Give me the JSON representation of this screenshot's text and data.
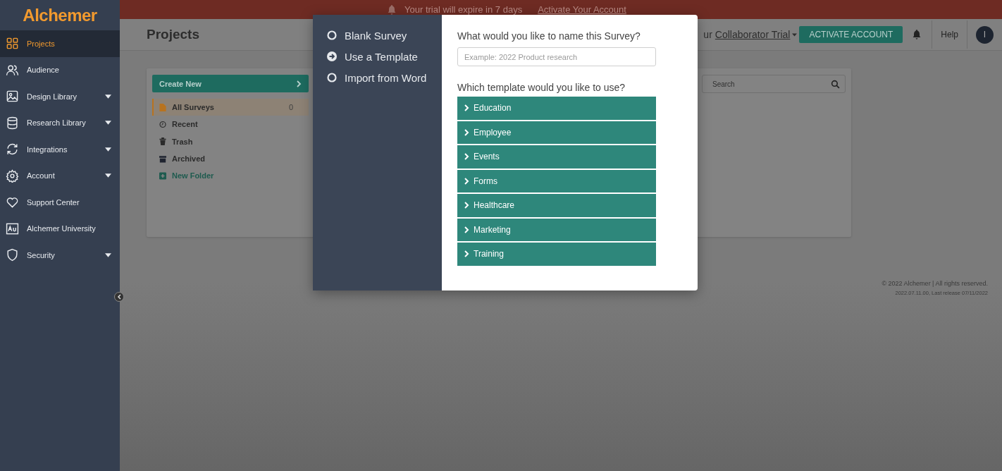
{
  "sidebar": {
    "logo": "Alchemer",
    "items": [
      {
        "label": "Projects",
        "selected": true,
        "has_submenu": false
      },
      {
        "label": "Audience",
        "selected": false,
        "has_submenu": false
      },
      {
        "label": "Design Library",
        "selected": false,
        "has_submenu": true
      },
      {
        "label": "Research Library",
        "selected": false,
        "has_submenu": true
      },
      {
        "label": "Integrations",
        "selected": false,
        "has_submenu": true
      },
      {
        "label": "Account",
        "selected": false,
        "has_submenu": true
      },
      {
        "label": "Support Center",
        "selected": false,
        "has_submenu": false
      },
      {
        "label": "Alchemer University",
        "selected": false,
        "has_submenu": false
      },
      {
        "label": "Security",
        "selected": false,
        "has_submenu": true
      }
    ]
  },
  "banner": {
    "message": "Your trial will expire in 7 days",
    "link": "Activate Your Account"
  },
  "header": {
    "title": "Projects",
    "plan_prefix": "ur",
    "plan_link": "Collaborator Trial",
    "activate_button": "ACTIVATE ACCOUNT",
    "help": "Help",
    "avatar": "I"
  },
  "projects": {
    "create_button": "Create New",
    "search_placeholder": "Search",
    "folders": [
      {
        "label": "All Surveys",
        "kind": "folder",
        "count": "0",
        "selected": true
      },
      {
        "label": "Recent",
        "kind": "recent",
        "selected": false
      },
      {
        "label": "Trash",
        "kind": "trash",
        "selected": false
      },
      {
        "label": "Archived",
        "kind": "archive",
        "selected": false
      },
      {
        "label": "New Folder",
        "kind": "new",
        "selected": false
      }
    ]
  },
  "footer": {
    "copyright": "© 2022 Alchemer | All rights reserved.",
    "version": "2022.07.11.00, Last release 07/11/2022"
  },
  "modal": {
    "options": [
      {
        "label": "Blank Survey",
        "selected": false
      },
      {
        "label": "Use a Template",
        "selected": true
      },
      {
        "label": "Import from Word",
        "selected": false
      }
    ],
    "name_question": "What would you like to name this Survey?",
    "name_placeholder": "Example: 2022 Product research",
    "template_question": "Which template would you like to use?",
    "templates": [
      "Education",
      "Employee",
      "Events",
      "Forms",
      "Healthcare",
      "Marketing",
      "Training"
    ]
  }
}
